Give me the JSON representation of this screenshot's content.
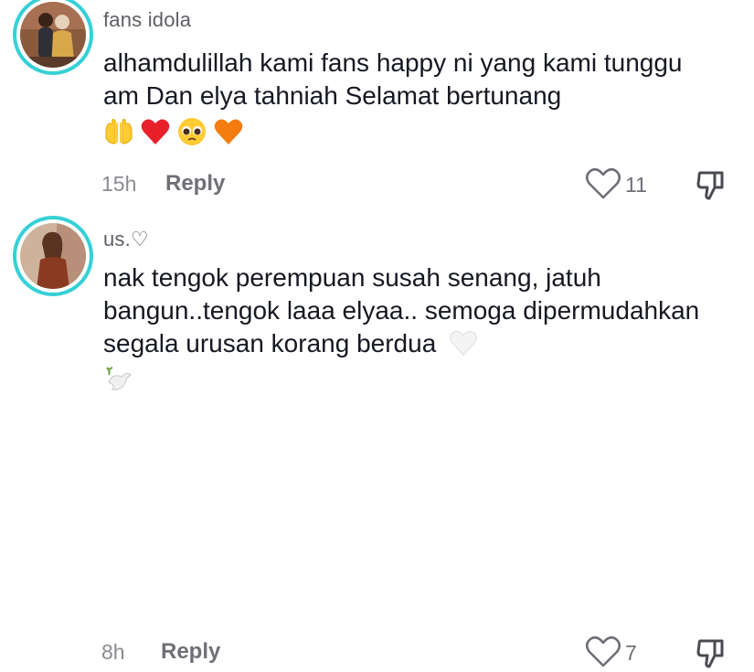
{
  "comments": [
    {
      "username": "fans idola",
      "text": "alhamdulillah kami fans happy ni yang kami tunggu am Dan elya tahniah Selamat bertunang",
      "emojis": [
        "raising-hands",
        "red-heart",
        "pleading-face",
        "orange-heart"
      ],
      "time": "15h",
      "reply_label": "Reply",
      "likes": "11"
    },
    {
      "username": "us.♡",
      "text": "nak tengok perempuan susah senang, jatuh bangun..tengok laaa elyaa.. semoga dipermudahkan segala urusan korang berdua",
      "emojis": [
        "white-heart",
        "dove"
      ],
      "time": "8h",
      "reply_label": "Reply",
      "likes": "7"
    }
  ],
  "colors": {
    "avatar_ring": "#35d0d6",
    "username": "#5e5e66",
    "meta": "#8a8b91"
  }
}
